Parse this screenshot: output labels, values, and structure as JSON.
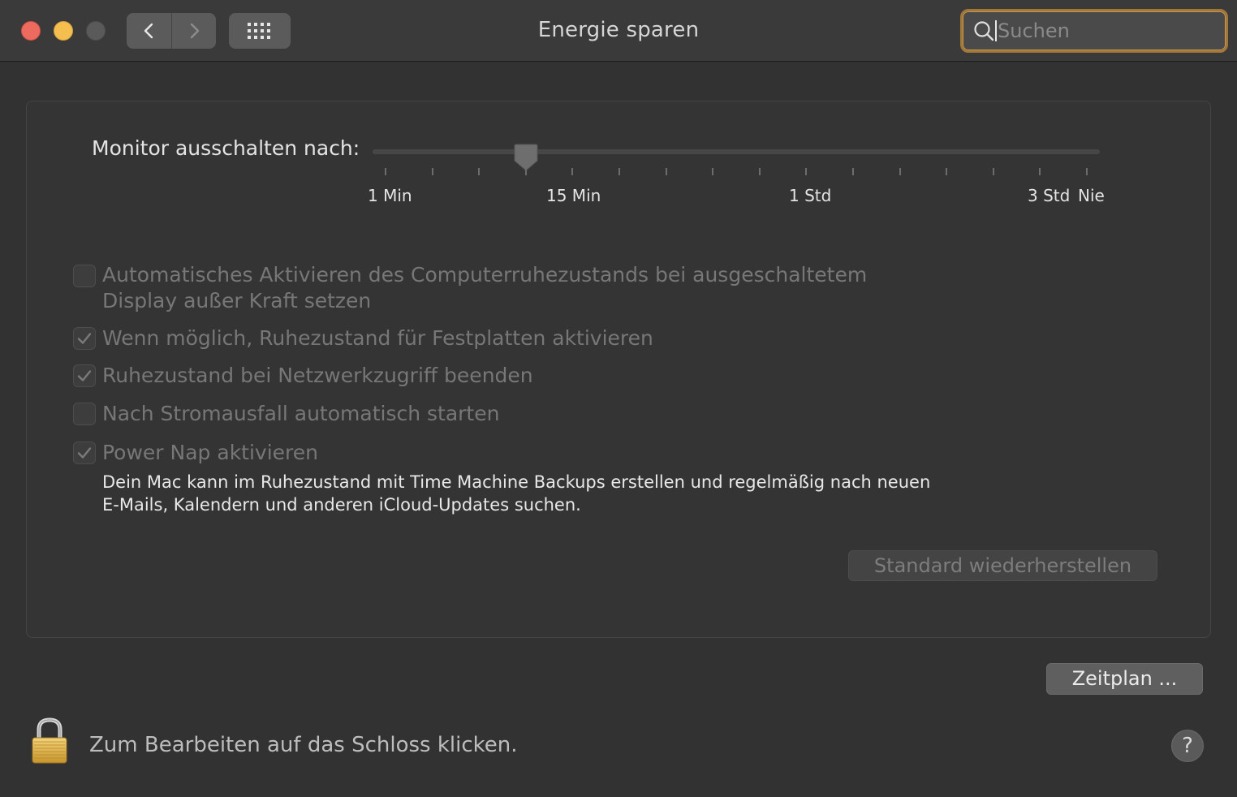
{
  "window": {
    "title": "Energie sparen"
  },
  "toolbar": {
    "back_icon": "chevron-left-icon",
    "forward_icon": "chevron-right-icon",
    "grid_icon": "grid-icon"
  },
  "search": {
    "placeholder": "Suchen",
    "value": ""
  },
  "display_sleep": {
    "label": "Monitor ausschalten nach:",
    "tick_labels": [
      "1 Min",
      "15 Min",
      "1 Std",
      "3 Std",
      "Nie"
    ],
    "value": "15 Min"
  },
  "options": [
    {
      "line1": "Automatisches Aktivieren des Computerruhezustands bei ausgeschaltetem",
      "line2": "Display außer Kraft setzen",
      "checked": false
    },
    {
      "line1": "Wenn möglich, Ruhezustand für Festplatten aktivieren",
      "checked": true
    },
    {
      "line1": "Ruhezustand bei Netzwerkzugriff beenden",
      "checked": true
    },
    {
      "line1": "Nach Stromausfall automatisch starten",
      "checked": false
    },
    {
      "line1": "Power Nap aktivieren",
      "checked": true
    }
  ],
  "power_nap_description": {
    "line1": "Dein Mac kann im Ruhezustand mit Time Machine Backups erstellen und regelmäßig nach neuen",
    "line2": "E-Mails, Kalendern und anderen iCloud-Updates suchen."
  },
  "buttons": {
    "restore": "Standard wiederherstellen",
    "schedule": "Zeitplan ..."
  },
  "footer": {
    "lock_text": "Zum Bearbeiten auf das Schloss klicken.",
    "help": "?"
  },
  "colors": {
    "window_bg": "#323232",
    "search_focus_ring": "#a1773a",
    "close": "#ed6a5e",
    "minimize": "#f5bf4f"
  }
}
